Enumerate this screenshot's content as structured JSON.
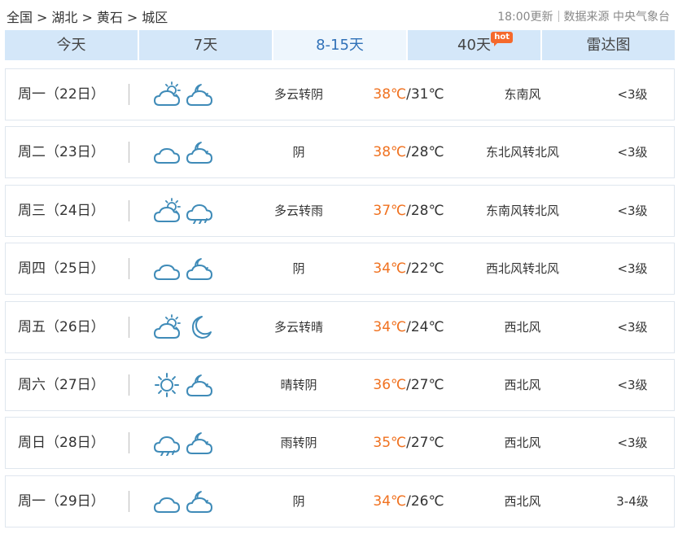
{
  "breadcrumb": {
    "items": [
      "全国",
      "湖北",
      "黄石",
      "城区"
    ],
    "separator": ">"
  },
  "meta": {
    "update_time": "18:00更新",
    "source_label": "数据来源",
    "source": "中央气象台"
  },
  "tabs": [
    {
      "label": "今天",
      "active": false
    },
    {
      "label": "7天",
      "active": false
    },
    {
      "label": "8-15天",
      "active": true
    },
    {
      "label": "40天",
      "active": false,
      "badge": "hot"
    },
    {
      "label": "雷达图",
      "active": false
    }
  ],
  "colors": {
    "accent_blue": "#3071b8",
    "tab_bg": "#d4e7f9",
    "tab_active_bg": "#eef6fd",
    "high_temp": "#f0711f",
    "hot_badge": "#f5692c",
    "icon_stroke": "#3f8bb8"
  },
  "forecast": [
    {
      "day": "周一（22日）",
      "icon_day": "partly-cloudy-icon",
      "icon_night": "cloudy-night-icon",
      "desc": "多云转阴",
      "high": "38℃",
      "low": "/31℃",
      "wind": "东南风",
      "level": "<3级"
    },
    {
      "day": "周二（23日）",
      "icon_day": "overcast-icon",
      "icon_night": "cloudy-night-icon",
      "desc": "阴",
      "high": "38℃",
      "low": "/28℃",
      "wind": "东北风转北风",
      "level": "<3级"
    },
    {
      "day": "周三（24日）",
      "icon_day": "partly-cloudy-icon",
      "icon_night": "rain-icon",
      "desc": "多云转雨",
      "high": "37℃",
      "low": "/28℃",
      "wind": "东南风转北风",
      "level": "<3级"
    },
    {
      "day": "周四（25日）",
      "icon_day": "overcast-icon",
      "icon_night": "cloudy-night-icon",
      "desc": "阴",
      "high": "34℃",
      "low": "/22℃",
      "wind": "西北风转北风",
      "level": "<3级"
    },
    {
      "day": "周五（26日）",
      "icon_day": "partly-cloudy-icon",
      "icon_night": "moon-icon",
      "desc": "多云转晴",
      "high": "34℃",
      "low": "/24℃",
      "wind": "西北风",
      "level": "<3级"
    },
    {
      "day": "周六（27日）",
      "icon_day": "sun-icon",
      "icon_night": "cloudy-night-icon",
      "desc": "晴转阴",
      "high": "36℃",
      "low": "/27℃",
      "wind": "西北风",
      "level": "<3级"
    },
    {
      "day": "周日（28日）",
      "icon_day": "rain-icon",
      "icon_night": "cloudy-night-icon",
      "desc": "雨转阴",
      "high": "35℃",
      "low": "/27℃",
      "wind": "西北风",
      "level": "<3级"
    },
    {
      "day": "周一（29日）",
      "icon_day": "overcast-icon",
      "icon_night": "cloudy-night-icon",
      "desc": "阴",
      "high": "34℃",
      "low": "/26℃",
      "wind": "西北风",
      "level": "3-4级"
    }
  ]
}
